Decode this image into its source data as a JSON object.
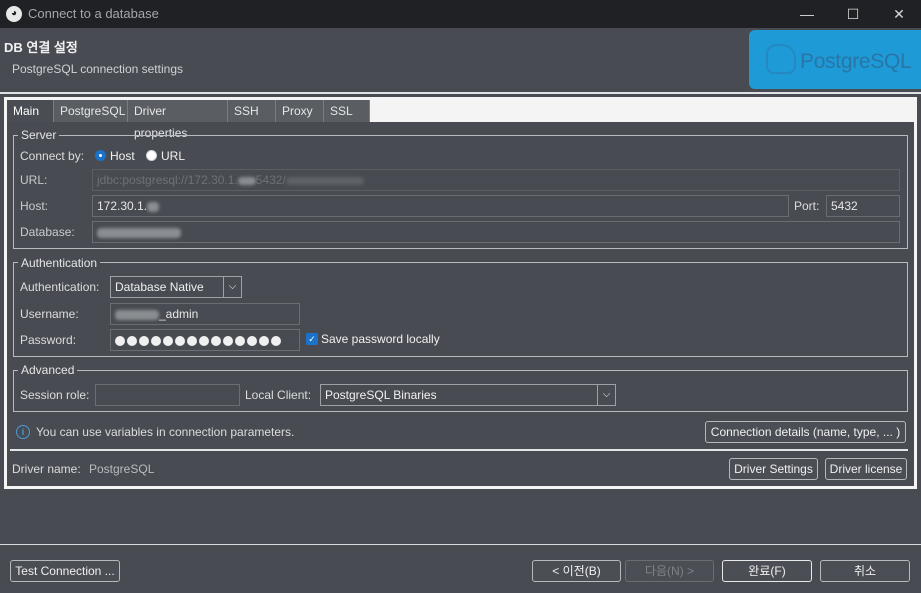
{
  "window": {
    "title": "Connect to a database",
    "minimize_icon": "minimize-icon",
    "maximize_icon": "maximize-icon",
    "close_icon": "close-icon"
  },
  "header": {
    "title": "DB 연결 설정",
    "subtitle": "PostgreSQL connection settings",
    "logo_text": "PostgreSQL"
  },
  "tabs": [
    {
      "label": "Main",
      "active": true
    },
    {
      "label": "PostgreSQL"
    },
    {
      "label": "Driver properties"
    },
    {
      "label": "SSH"
    },
    {
      "label": "Proxy"
    },
    {
      "label": "SSL"
    }
  ],
  "server": {
    "legend": "Server",
    "connect_by_label": "Connect by:",
    "option_host": "Host",
    "option_url": "URL",
    "selected": "Host",
    "url_label": "URL:",
    "url_value_prefix": "jdbc:postgresql://172.30.1.",
    "url_value_mid": "5432/",
    "host_label": "Host:",
    "host_value": "172.30.1.",
    "port_label": "Port:",
    "port_value": "5432",
    "database_label": "Database:"
  },
  "auth": {
    "legend": "Authentication",
    "auth_label": "Authentication:",
    "auth_value": "Database Native",
    "username_label": "Username:",
    "username_suffix": "_admin",
    "password_label": "Password:",
    "password_length": 14,
    "save_password_label": "Save password locally",
    "save_password_checked": true
  },
  "advanced": {
    "legend": "Advanced",
    "session_role_label": "Session role:",
    "session_role_value": "",
    "local_client_label": "Local Client:",
    "local_client_value": "PostgreSQL Binaries"
  },
  "info": {
    "message": "You can use variables in connection parameters.",
    "details_button": "Connection details (name, type, ... )"
  },
  "driver": {
    "label": "Driver name:",
    "value": "PostgreSQL",
    "settings_button": "Driver Settings",
    "license_button": "Driver license"
  },
  "footer": {
    "test_button": "Test Connection ...",
    "back_button": "< 이전(B)",
    "next_button": "다음(N) >",
    "finish_button": "완료(F)",
    "cancel_button": "취소"
  }
}
